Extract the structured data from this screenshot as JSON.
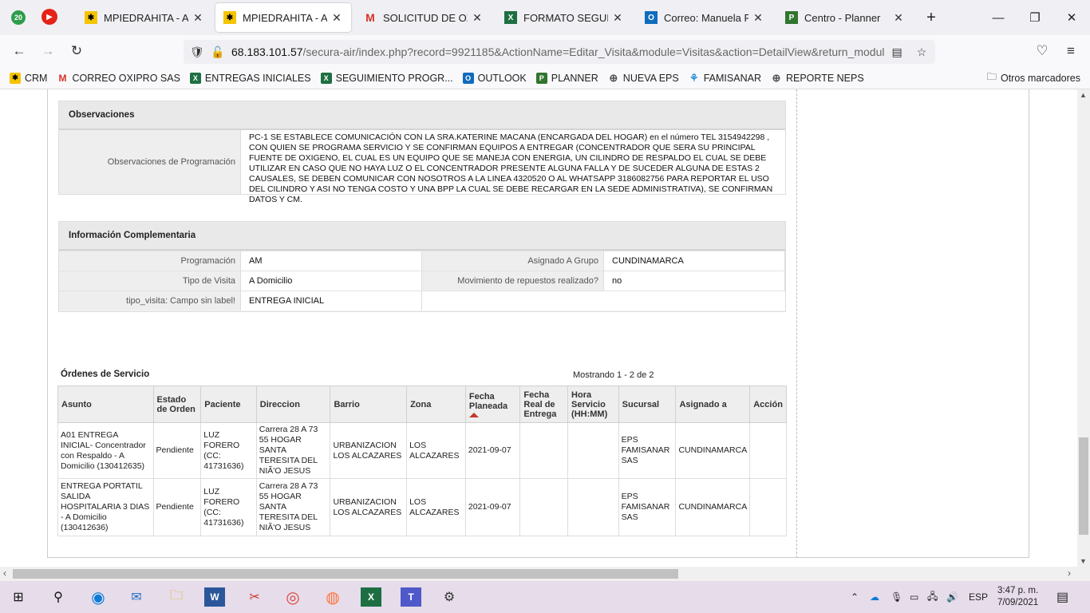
{
  "browser": {
    "tabs": [
      {
        "title": "MPIEDRAHITA - Atención",
        "active": false
      },
      {
        "title": "MPIEDRAHITA - Atención",
        "active": true
      },
      {
        "title": "SOLICITUD DE OXÍGENO",
        "active": false
      },
      {
        "title": "FORMATO SEGUIMIENTO",
        "active": false
      },
      {
        "title": "Correo: Manuela Piedrahita",
        "active": false
      },
      {
        "title": "Centro - Planner",
        "active": false
      }
    ],
    "badge_count": "20",
    "url_host": "68.183.101.57",
    "url_path": "/secura-air/index.php?record=9921185&ActionName=Editar_Visita&module=Visitas&action=DetailView&return_modul",
    "bookmarks": [
      "CRM",
      "CORREO OXIPRO SAS",
      "ENTREGAS INICIALES",
      "SEGUIMIENTO PROGR...",
      "OUTLOOK",
      "PLANNER",
      "NUEVA EPS",
      "FAMISANAR",
      "REPORTE NEPS"
    ],
    "other_bookmarks": "Otros marcadores"
  },
  "observaciones": {
    "title": "Observaciones",
    "label": "Observaciones de Programación",
    "text": "PC-1 SE ESTABLECE COMUNICACIÓN CON LA SRA.KATERINE MACANA (ENCARGADA DEL HOGAR) en el número TEL 3154942298 , CON QUIEN SE PROGRAMA SERVICIO Y SE CONFIRMAN EQUIPOS A ENTREGAR (CONCENTRADOR QUE SERA SU PRINCIPAL FUENTE DE OXIGENO, EL CUAL ES UN EQUIPO QUE SE MANEJA CON ENERGIA, UN CILINDRO DE RESPALDO EL CUAL SE DEBE UTILIZAR EN CASO QUE NO HAYA LUZ O EL CONCENTRADOR PRESENTE ALGUNA FALLA Y DE SUCEDER ALGUNA DE ESTAS 2 CAUSALES, SE DEBEN COMUNICAR CON NOSOTROS A LA LINEA 4320520 O AL WHATSAPP 3186082756 PARA REPORTAR EL USO DEL CILINDRO Y ASI NO TENGA COSTO Y UNA BPP LA CUAL SE DEBE RECARGAR EN LA SEDE ADMINISTRATIVA), SE CONFIRMAN DATOS Y CM."
  },
  "info": {
    "title": "Información Complementaria",
    "programacion_label": "Programación",
    "programacion_value": "AM",
    "asignado_label": "Asignado A Grupo",
    "asignado_value": "CUNDINAMARCA",
    "tipo_label": "Tipo de Visita",
    "tipo_value": "A Domicilio",
    "mov_label": "Movimiento de repuestos realizado?",
    "mov_value": "no",
    "tv_label": "tipo_visita: Campo sin label!",
    "tv_value": "ENTREGA INICIAL"
  },
  "orders": {
    "title": "Órdenes de Servicio",
    "count": "Mostrando 1 - 2 de 2",
    "headers": [
      "Asunto",
      "Estado de Orden",
      "Paciente",
      "Direccion",
      "Barrio",
      "Zona",
      "Fecha Planeada",
      "Fecha Real de Entrega",
      "Hora Servicio (HH:MM)",
      "Sucursal",
      "Asignado a",
      "Acción"
    ],
    "rows": [
      [
        "A01 ENTREGA INICIAL- Concentrador con Respaldo - A Domicilio (130412635)",
        "Pendiente",
        "LUZ FORERO (CC: 41731636)",
        "Carrera 28 A 73 55 HOGAR SANTA TERESITA DEL NIÃ'O JESUS",
        "URBANIZACION LOS ALCAZARES",
        "LOS ALCAZARES",
        "2021-09-07",
        "",
        "",
        "EPS FAMISANAR SAS",
        "CUNDINAMARCA",
        ""
      ],
      [
        "ENTREGA PORTATIL SALIDA HOSPITALARIA 3 DIAS - A Domicilio (130412636)",
        "Pendiente",
        "LUZ FORERO (CC: 41731636)",
        "Carrera 28 A 73 55 HOGAR SANTA TERESITA DEL NIÃ'O JESUS",
        "URBANIZACION LOS ALCAZARES",
        "LOS ALCAZARES",
        "2021-09-07",
        "",
        "",
        "EPS FAMISANAR SAS",
        "CUNDINAMARCA",
        ""
      ]
    ]
  },
  "taskbar": {
    "lang": "ESP",
    "time": "3:47 p. m.",
    "date": "7/09/2021"
  },
  "colors": {
    "accent_red": "#c0392b",
    "taskbar_bg": "#e6dcea"
  }
}
